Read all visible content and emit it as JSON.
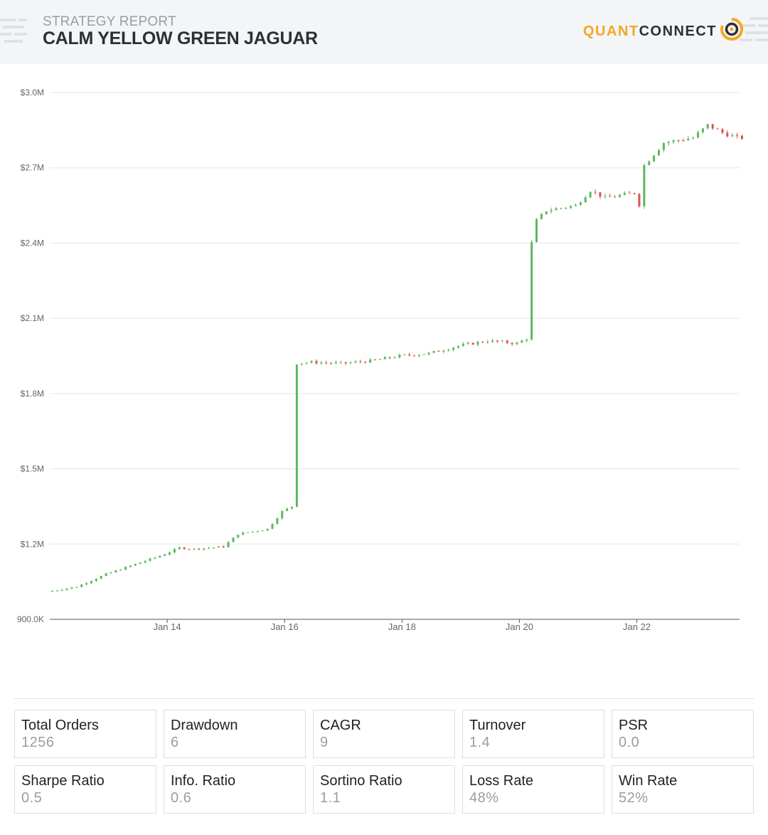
{
  "header": {
    "subtitle": "STRATEGY REPORT",
    "title": "CALM YELLOW GREEN JAGUAR",
    "logo_left": "QUANT",
    "logo_right": "CONNECT"
  },
  "colors": {
    "up": "#5cb85c",
    "down": "#d9534f",
    "grid": "#e6e6e6",
    "axis_text": "#666666",
    "brand_orange": "#f5a623"
  },
  "chart_data": {
    "type": "candlestick",
    "title": "",
    "xlabel": "",
    "ylabel": "",
    "ylim": [
      900000,
      3000000
    ],
    "yticks": [
      900000,
      1200000,
      1500000,
      1800000,
      2100000,
      2400000,
      2700000,
      3000000
    ],
    "ytick_labels": [
      "900.0K",
      "$1.2M",
      "$1.5M",
      "$1.8M",
      "$2.1M",
      "$2.4M",
      "$2.7M",
      "$3.0M"
    ],
    "xlim": [
      "2024-01-12",
      "2024-01-23T18:00"
    ],
    "xticks": [
      "2024-01-14",
      "2024-01-16",
      "2024-01-18",
      "2024-01-20",
      "2024-01-22"
    ],
    "xtick_labels": [
      "Jan 14",
      "Jan 16",
      "Jan 18",
      "Jan 20",
      "Jan 22"
    ],
    "grid": true,
    "series": [
      {
        "points": [
          [
            "2024-01-12",
            1010000
          ],
          [
            "2024-01-12T12:00",
            1030000
          ],
          [
            "2024-01-13",
            1080000
          ],
          [
            "2024-01-13T12:00",
            1120000
          ],
          [
            "2024-01-14",
            1160000
          ],
          [
            "2024-01-14T06:00",
            1185000
          ],
          [
            "2024-01-14T12:00",
            1180000
          ],
          [
            "2024-01-15",
            1190000
          ],
          [
            "2024-01-15T06:00",
            1240000
          ],
          [
            "2024-01-15T18:00",
            1260000
          ],
          [
            "2024-01-16",
            1330000
          ],
          [
            "2024-01-16T04:00",
            1350000
          ],
          [
            "2024-01-16T05:00",
            1920000
          ],
          [
            "2024-01-16T12:00",
            1925000
          ],
          [
            "2024-01-17",
            1920000
          ],
          [
            "2024-01-17T12:00",
            1930000
          ],
          [
            "2024-01-18",
            1950000
          ],
          [
            "2024-01-18T12:00",
            1960000
          ],
          [
            "2024-01-19",
            1990000
          ],
          [
            "2024-01-19T12:00",
            2010000
          ],
          [
            "2024-01-20",
            2000000
          ],
          [
            "2024-01-20T04:00",
            2020000
          ],
          [
            "2024-01-20T05:00",
            2320000
          ],
          [
            "2024-01-20T07:00",
            2480000
          ],
          [
            "2024-01-20T12:00",
            2530000
          ],
          [
            "2024-01-21",
            2550000
          ],
          [
            "2024-01-21T06:00",
            2610000
          ],
          [
            "2024-01-21T12:00",
            2580000
          ],
          [
            "2024-01-22",
            2600000
          ],
          [
            "2024-01-22T03:00",
            2530000
          ],
          [
            "2024-01-22T04:00",
            2710000
          ],
          [
            "2024-01-22T12:00",
            2800000
          ],
          [
            "2024-01-23",
            2820000
          ],
          [
            "2024-01-23T06:00",
            2870000
          ],
          [
            "2024-01-23T12:00",
            2840000
          ],
          [
            "2024-01-23T18:00",
            2820000
          ]
        ]
      }
    ]
  },
  "stats": [
    {
      "label": "Total Orders",
      "value": "1256"
    },
    {
      "label": "Drawdown",
      "value": "6"
    },
    {
      "label": "CAGR",
      "value": "9"
    },
    {
      "label": "Turnover",
      "value": "1.4"
    },
    {
      "label": "PSR",
      "value": "0.0"
    },
    {
      "label": "Sharpe Ratio",
      "value": "0.5"
    },
    {
      "label": "Info. Ratio",
      "value": "0.6"
    },
    {
      "label": "Sortino Ratio",
      "value": "1.1"
    },
    {
      "label": "Loss Rate",
      "value": "48%"
    },
    {
      "label": "Win Rate",
      "value": "52%"
    }
  ]
}
